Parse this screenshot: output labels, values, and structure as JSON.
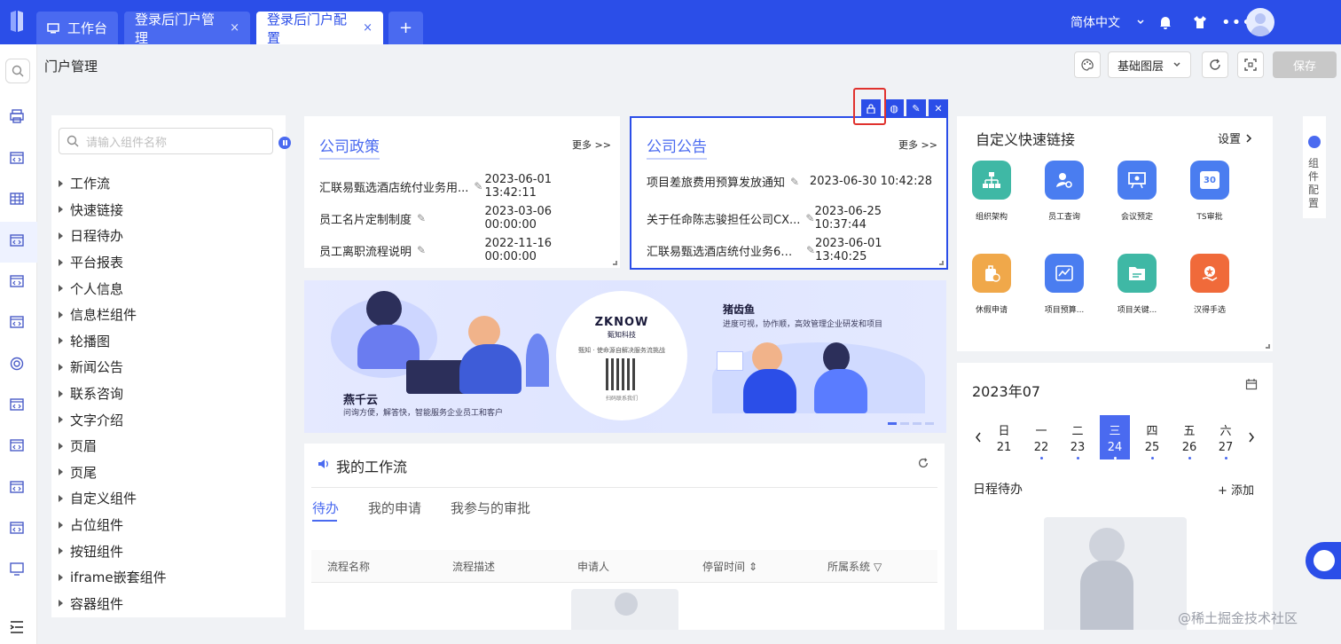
{
  "tabs": [
    {
      "label": "工作台",
      "icon": "monitor-icon"
    },
    {
      "label": "登录后门户管理",
      "close": "×"
    },
    {
      "label": "登录后门户配置",
      "close": "×"
    },
    {
      "label": "+"
    }
  ],
  "header": {
    "language": "简体中文",
    "icons": [
      "bell-icon",
      "shirt-icon",
      "more-icon",
      "avatar"
    ]
  },
  "page": {
    "title": "门户管理"
  },
  "toolbar": {
    "layer_select": "基础图层",
    "save_label": "保存"
  },
  "left_panel": {
    "search_placeholder": "请输入组件名称",
    "items": [
      "工作流",
      "快速链接",
      "日程待办",
      "平台报表",
      "个人信息",
      "信息栏组件",
      "轮播图",
      "新闻公告",
      "联系咨询",
      "文字介绍",
      "页眉",
      "页尾",
      "自定义组件",
      "占位组件",
      "按钮组件",
      "iframe嵌套组件",
      "容器组件"
    ]
  },
  "policy": {
    "title": "公司政策",
    "more": "更多 >>",
    "rows": [
      {
        "title": "汇联易甄选酒店统付业务用...",
        "time": "2023-06-01 13:42:11"
      },
      {
        "title": "员工名片定制制度",
        "time": "2023-03-06 00:00:00"
      },
      {
        "title": "员工离职流程说明",
        "time": "2022-11-16 00:00:00"
      }
    ]
  },
  "notice": {
    "title": "公司公告",
    "more": "更多 >>",
    "rows": [
      {
        "title": "项目差旅费用预算发放通知",
        "time": "2023-06-30 10:42:28"
      },
      {
        "title": "关于任命陈志骏担任公司CX...",
        "time": "2023-06-25 10:37:44"
      },
      {
        "title": "汇联易甄选酒店统付业务6月...",
        "time": "2023-06-01 13:40:25"
      }
    ]
  },
  "banner": {
    "left_title": "燕千云",
    "left_sub": "问询方便，解答快，智能服务企业员工和客户",
    "center_logo": "ZKNOW",
    "center_logo_sub": "甄知科技",
    "center_text": "甄知 · 使命源自解决服务流挑战",
    "center_qr_caption": "扫码联系我们",
    "right_title": "猪齿鱼",
    "right_sub": "进度可视，协作顺，高效管理企业研发和项目"
  },
  "workflow": {
    "title": "我的工作流",
    "tabs": [
      "待办",
      "我的申请",
      "我参与的审批"
    ],
    "columns": [
      "流程名称",
      "流程描述",
      "申请人",
      "停留时间",
      "所属系统"
    ]
  },
  "quicklinks": {
    "title": "自定义快速链接",
    "settings": "设置",
    "items": [
      {
        "label": "组织架构",
        "color": "#3fb8a5",
        "icon": "org-chart-icon"
      },
      {
        "label": "员工查询",
        "color": "#4a7df0",
        "icon": "user-search-icon"
      },
      {
        "label": "会议预定",
        "color": "#4a7df0",
        "icon": "meeting-icon"
      },
      {
        "label": "TS审批",
        "color": "#4a7df0",
        "icon": "calendar-icon",
        "badge": "30"
      },
      {
        "label": "休假申请",
        "color": "#f0a84a",
        "icon": "leave-icon"
      },
      {
        "label": "项目预算...",
        "color": "#4a7df0",
        "icon": "budget-icon"
      },
      {
        "label": "项目关键...",
        "color": "#3fb8a5",
        "icon": "folder-icon"
      },
      {
        "label": "汉得手选",
        "color": "#f06a3a",
        "icon": "star-hand-icon"
      }
    ]
  },
  "calendar": {
    "month": "2023年07",
    "days": [
      {
        "weekday": "日",
        "date": "21"
      },
      {
        "weekday": "一",
        "date": "22"
      },
      {
        "weekday": "二",
        "date": "23"
      },
      {
        "weekday": "三",
        "date": "24",
        "selected": true
      },
      {
        "weekday": "四",
        "date": "25"
      },
      {
        "weekday": "五",
        "date": "26"
      },
      {
        "weekday": "六",
        "date": "27"
      }
    ],
    "schedule_title": "日程待办",
    "add_label": "+ 添加"
  },
  "side_config": {
    "label": "组件配置"
  },
  "watermark": "@稀土掘金技术社区"
}
